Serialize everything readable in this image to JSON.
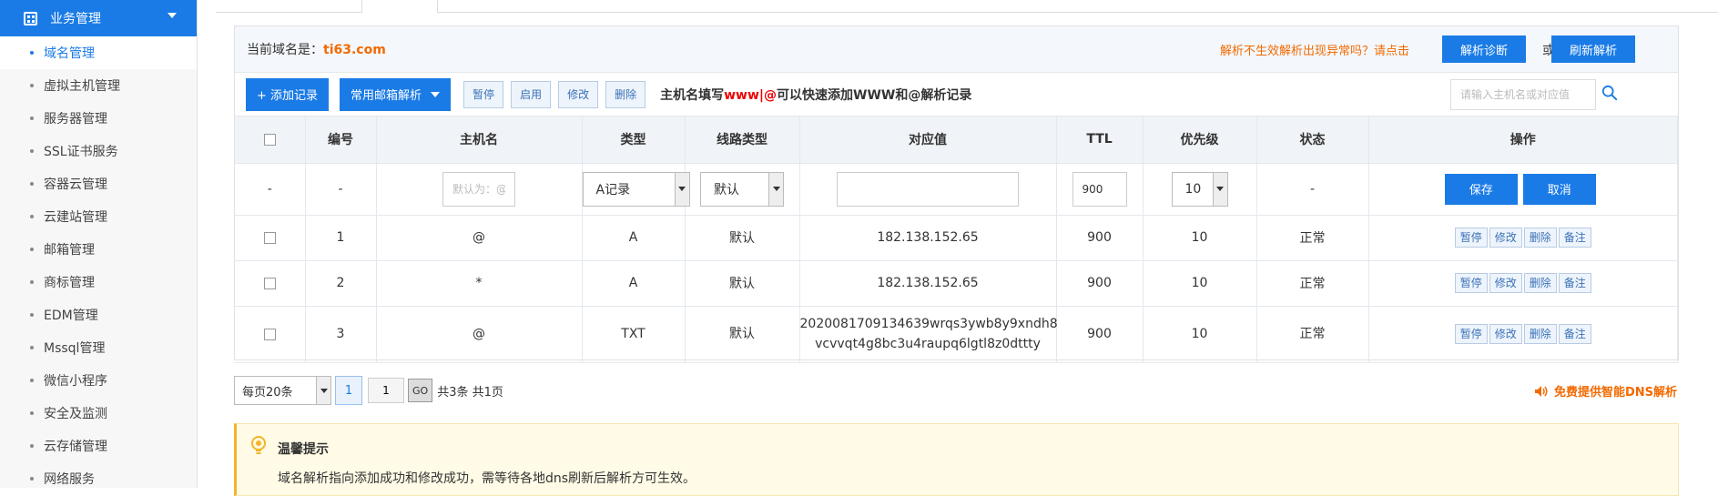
{
  "sidebar": {
    "header": "业务管理",
    "items": [
      {
        "label": "域名管理",
        "active": true
      },
      {
        "label": "虚拟主机管理"
      },
      {
        "label": "服务器管理"
      },
      {
        "label": "SSL证书服务"
      },
      {
        "label": "容器云管理"
      },
      {
        "label": "云建站管理"
      },
      {
        "label": "邮箱管理"
      },
      {
        "label": "商标管理"
      },
      {
        "label": "EDM管理"
      },
      {
        "label": "Mssql管理"
      },
      {
        "label": "微信小程序"
      },
      {
        "label": "安全及监测"
      },
      {
        "label": "云存储管理"
      },
      {
        "label": "网络服务"
      }
    ]
  },
  "panel": {
    "domain_label": "当前域名是：",
    "domain_value": "ti63.com",
    "notice": "解析不生效解析出现异常吗？请点击",
    "diagnose_button": "解析诊断",
    "or_text": "或",
    "refresh_button": "刷新解析"
  },
  "toolbar": {
    "add_button": "+ 添加记录",
    "mail_button": "常用邮箱解析",
    "pause_button": "暂停",
    "enable_button": "启用",
    "modify_button": "修改",
    "delete_button": "删除",
    "hint_prefix": "主机名填写",
    "hint_www": "www",
    "hint_sep": "|",
    "hint_at": "@",
    "hint_suffix": "可以快速添加WWW和@解析记录",
    "search_placeholder": "请输入主机名或对应值"
  },
  "table": {
    "headers": [
      "编号",
      "主机名",
      "类型",
      "线路类型",
      "对应值",
      "TTL",
      "优先级",
      "状态",
      "操作"
    ],
    "edit_row": {
      "dash1": "-",
      "dash2": "-",
      "host_placeholder": "默认为：@",
      "type": "A记录",
      "line": "默认",
      "value": "",
      "ttl": "900",
      "priority": "10",
      "status": "-",
      "save": "保存",
      "cancel": "取消"
    },
    "rows": [
      {
        "id": "1",
        "host": "@",
        "type": "A",
        "line": "默认",
        "value": "182.138.152.65",
        "value2": "",
        "ttl": "900",
        "priority": "10",
        "status": "正常"
      },
      {
        "id": "2",
        "host": "*",
        "type": "A",
        "line": "默认",
        "value": "182.138.152.65",
        "value2": "",
        "ttl": "900",
        "priority": "10",
        "status": "正常"
      },
      {
        "id": "3",
        "host": "@",
        "type": "TXT",
        "line": "默认",
        "value": "2020081709134639wrqs3ywb8y9xndh8",
        "value2": "vcvvqt4g8bc3u4raupq6lgtl8z0dttty",
        "ttl": "900",
        "priority": "10",
        "status": "正常"
      }
    ],
    "row_actions": [
      "暂停",
      "修改",
      "删除",
      "备注"
    ]
  },
  "pager": {
    "per_page": "每页20条",
    "current_page": "1",
    "page_input": "1",
    "go": "GO",
    "summary": "共3条 共1页"
  },
  "dns_link": "免费提供智能DNS解析",
  "tips": {
    "title": "温馨提示",
    "text": "域名解析指向添加成功和修改成功，需等待各地dns刷新后解析方可生效。"
  },
  "colors": {
    "primary": "#1a7be6",
    "accent": "#f26a00",
    "status_ok": "#1a9e4a",
    "warning": "#e00000"
  }
}
